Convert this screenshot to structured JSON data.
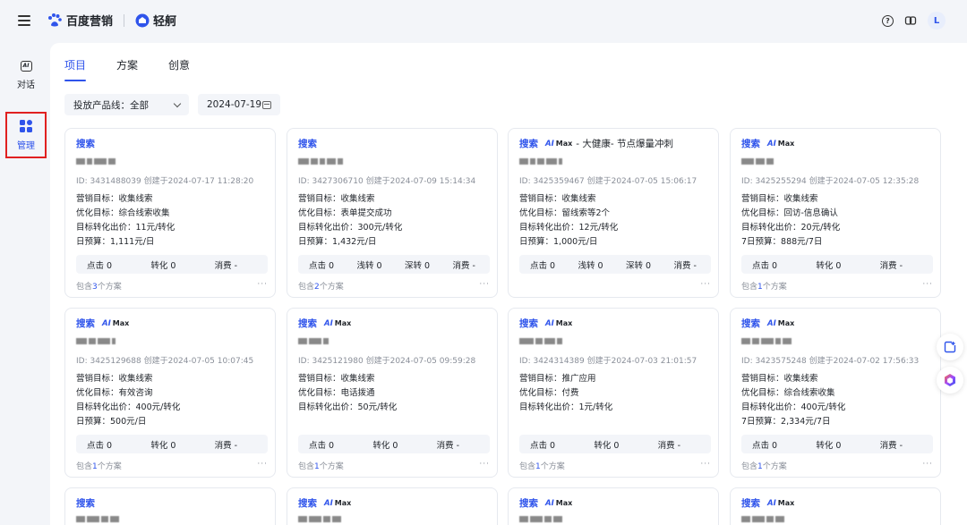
{
  "brand": {
    "name": "百度营销",
    "product": "轻舸"
  },
  "header": {
    "avatar_letter": "L",
    "help_icon": "help-circle-icon",
    "link_icon": "link-icon"
  },
  "sidebar": {
    "items": [
      {
        "label": "对话",
        "icon": "ai-chat-icon"
      },
      {
        "label": "管理",
        "icon": "manage-grid-icon"
      }
    ]
  },
  "tabs": [
    "项目",
    "方案",
    "创意"
  ],
  "filters": {
    "product_line": "投放产品线：全部",
    "date": "2024-07-19"
  },
  "colors": {
    "accent": "#2f54eb",
    "highlight_border": "#e02020"
  },
  "cards": [
    {
      "tag": "搜索",
      "aimax": false,
      "suffix": "",
      "meta": "ID: 3431488039  创建于2024-07-17 11:28:20",
      "info": [
        "营销目标：收集线索",
        "优化目标：综合线索收集",
        "目标转化出价：11元/转化",
        "日预算：1,111元/日"
      ],
      "stats": [
        "点击 0",
        "转化 0",
        "消费 -"
      ],
      "plans_pre": "包含",
      "plans_num": "3",
      "plans_post": "个方案"
    },
    {
      "tag": "搜索",
      "aimax": false,
      "suffix": "",
      "meta": "ID: 3427306710  创建于2024-07-09 15:14:34",
      "info": [
        "营销目标：收集线索",
        "优化目标：表单提交成功",
        "目标转化出价：300元/转化",
        "日预算：1,432元/日"
      ],
      "stats": [
        "点击 0",
        "浅转 0",
        "深转 0",
        "消费 -"
      ],
      "plans_pre": "包含",
      "plans_num": "2",
      "plans_post": "个方案"
    },
    {
      "tag": "搜索",
      "aimax": true,
      "suffix": "- 大健康- 节点爆量冲刺",
      "meta": "ID: 3425359467  创建于2024-07-05 15:06:17",
      "info": [
        "营销目标：收集线索",
        "优化目标：留线索等2个",
        "目标转化出价：12元/转化",
        "日预算：1,000元/日"
      ],
      "stats": [
        "点击 0",
        "浅转 0",
        "深转 0",
        "消费 -"
      ],
      "plans_pre": "",
      "plans_num": "",
      "plans_post": ""
    },
    {
      "tag": "搜索",
      "aimax": true,
      "suffix": "",
      "meta": "ID: 3425255294  创建于2024-07-05 12:35:28",
      "info": [
        "营销目标：收集线索",
        "优化目标：回访-信息确认",
        "目标转化出价：20元/转化",
        "7日预算：888元/7日"
      ],
      "stats": [
        "点击 0",
        "转化 0",
        "消费 -"
      ],
      "plans_pre": "包含",
      "plans_num": "1",
      "plans_post": "个方案"
    },
    {
      "tag": "搜索",
      "aimax": true,
      "suffix": "",
      "meta": "ID: 3425129688  创建于2024-07-05 10:07:45",
      "info": [
        "营销目标：收集线索",
        "优化目标：有效咨询",
        "目标转化出价：400元/转化",
        "日预算：500元/日"
      ],
      "stats": [
        "点击 0",
        "转化 0",
        "消费 -"
      ],
      "plans_pre": "包含",
      "plans_num": "1",
      "plans_post": "个方案"
    },
    {
      "tag": "搜索",
      "aimax": true,
      "suffix": "",
      "meta": "ID: 3425121980  创建于2024-07-05 09:59:28",
      "info": [
        "营销目标：收集线索",
        "优化目标：电话拨通",
        "目标转化出价：50元/转化"
      ],
      "stats": [
        "点击 0",
        "转化 0",
        "消费 -"
      ],
      "plans_pre": "包含",
      "plans_num": "1",
      "plans_post": "个方案"
    },
    {
      "tag": "搜索",
      "aimax": true,
      "suffix": "",
      "meta": "ID: 3424314389  创建于2024-07-03 21:01:57",
      "info": [
        "营销目标：推广应用",
        "优化目标：付费",
        "目标转化出价：1元/转化"
      ],
      "stats": [
        "点击 0",
        "转化 0",
        "消费 -"
      ],
      "plans_pre": "包含",
      "plans_num": "1",
      "plans_post": "个方案"
    },
    {
      "tag": "搜索",
      "aimax": true,
      "suffix": "",
      "meta": "ID: 3423575248  创建于2024-07-02 17:56:33",
      "info": [
        "营销目标：收集线索",
        "优化目标：综合线索收集",
        "目标转化出价：400元/转化",
        "7日预算：2,334元/7日"
      ],
      "stats": [
        "点击 0",
        "转化 0",
        "消费 -"
      ],
      "plans_pre": "包含",
      "plans_num": "1",
      "plans_post": "个方案"
    },
    {
      "tag": "搜索",
      "aimax": false,
      "suffix": "",
      "meta": "",
      "info": [],
      "stats": [],
      "plans_pre": "",
      "plans_num": "",
      "plans_post": ""
    },
    {
      "tag": "搜索",
      "aimax": true,
      "suffix": "",
      "meta": "",
      "info": [],
      "stats": [],
      "plans_pre": "",
      "plans_num": "",
      "plans_post": ""
    },
    {
      "tag": "搜索",
      "aimax": true,
      "suffix": "",
      "meta": "",
      "info": [],
      "stats": [],
      "plans_pre": "",
      "plans_num": "",
      "plans_post": ""
    },
    {
      "tag": "搜索",
      "aimax": true,
      "suffix": "",
      "meta": "",
      "info": [],
      "stats": [],
      "plans_pre": "",
      "plans_num": "",
      "plans_post": ""
    }
  ],
  "aimax_label": {
    "ai": "AI",
    "max": "Max"
  },
  "float_buttons": [
    "note-add-icon",
    "ai-assistant-icon"
  ]
}
